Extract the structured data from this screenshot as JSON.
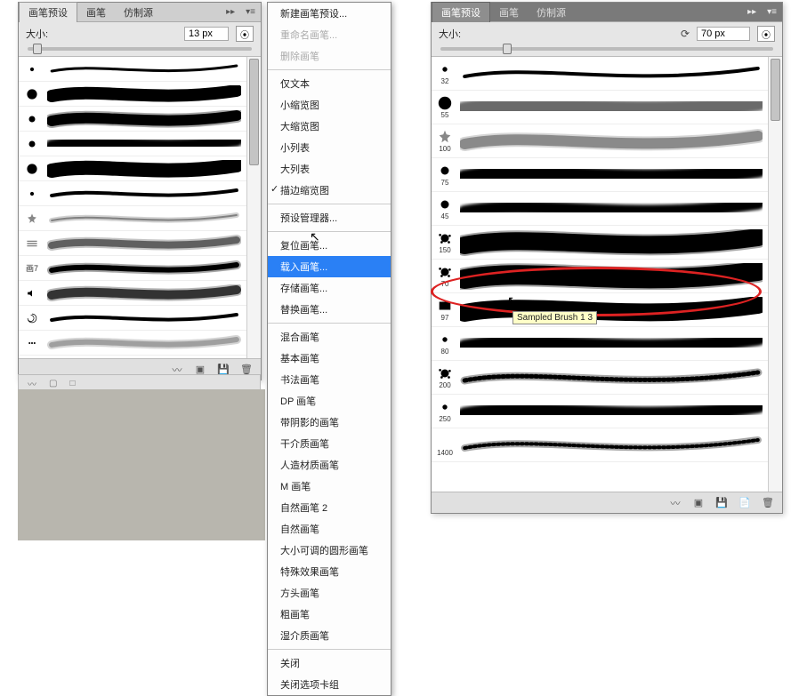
{
  "panel1": {
    "tabs": [
      "画笔预设",
      "画笔",
      "仿制源"
    ],
    "size_label": "大小:",
    "size_value": "13 px",
    "brushes": [
      {
        "num": "",
        "tip": "dot-sm"
      },
      {
        "num": "",
        "tip": "dot-lg"
      },
      {
        "num": "",
        "tip": "dot-md"
      },
      {
        "num": "",
        "tip": "dot-md"
      },
      {
        "num": "",
        "tip": "dot-lg"
      },
      {
        "num": "",
        "tip": "dot-sm"
      },
      {
        "num": "",
        "tip": "star"
      },
      {
        "num": "",
        "tip": "lines"
      },
      {
        "num": "画7",
        "tip": "label"
      },
      {
        "num": "",
        "tip": "sound"
      },
      {
        "num": "",
        "tip": "swirl"
      },
      {
        "num": "",
        "tip": "dots"
      }
    ]
  },
  "menu": {
    "items": [
      {
        "label": "新建画笔预设...",
        "type": "item"
      },
      {
        "label": "重命名画笔...",
        "type": "disabled"
      },
      {
        "label": "删除画笔",
        "type": "disabled"
      },
      {
        "type": "sep"
      },
      {
        "label": "仅文本",
        "type": "item"
      },
      {
        "label": "小缩览图",
        "type": "item"
      },
      {
        "label": "大缩览图",
        "type": "item"
      },
      {
        "label": "小列表",
        "type": "item"
      },
      {
        "label": "大列表",
        "type": "item"
      },
      {
        "label": "描边缩览图",
        "type": "checked"
      },
      {
        "type": "sep"
      },
      {
        "label": "预设管理器...",
        "type": "item"
      },
      {
        "type": "sep"
      },
      {
        "label": "复位画笔...",
        "type": "item"
      },
      {
        "label": "载入画笔...",
        "type": "highlight"
      },
      {
        "label": "存储画笔...",
        "type": "item"
      },
      {
        "label": "替换画笔...",
        "type": "item"
      },
      {
        "type": "sep"
      },
      {
        "label": "混合画笔",
        "type": "item"
      },
      {
        "label": "基本画笔",
        "type": "item"
      },
      {
        "label": "书法画笔",
        "type": "item"
      },
      {
        "label": "DP 画笔",
        "type": "item"
      },
      {
        "label": "带阴影的画笔",
        "type": "item"
      },
      {
        "label": "干介质画笔",
        "type": "item"
      },
      {
        "label": "人造材质画笔",
        "type": "item"
      },
      {
        "label": "M 画笔",
        "type": "item"
      },
      {
        "label": "自然画笔 2",
        "type": "item"
      },
      {
        "label": "自然画笔",
        "type": "item"
      },
      {
        "label": "大小可调的圆形画笔",
        "type": "item"
      },
      {
        "label": "特殊效果画笔",
        "type": "item"
      },
      {
        "label": "方头画笔",
        "type": "item"
      },
      {
        "label": "粗画笔",
        "type": "item"
      },
      {
        "label": "湿介质画笔",
        "type": "item"
      },
      {
        "type": "sep"
      },
      {
        "label": "关闭",
        "type": "item"
      },
      {
        "label": "关闭选项卡组",
        "type": "item"
      }
    ]
  },
  "panel2": {
    "tabs": [
      "画笔预设",
      "画笔",
      "仿制源"
    ],
    "size_label": "大小:",
    "size_value": "70 px",
    "tooltip": "Sampled Brush 1 3",
    "brushes": [
      {
        "num": "32",
        "tip": "dot-sm"
      },
      {
        "num": "55",
        "tip": "dot-lg"
      },
      {
        "num": "100",
        "tip": "star"
      },
      {
        "num": "75",
        "tip": "dot-md"
      },
      {
        "num": "45",
        "tip": "dot-md"
      },
      {
        "num": "150",
        "tip": "splat"
      },
      {
        "num": "70",
        "tip": "splat"
      },
      {
        "num": "97",
        "tip": "square"
      },
      {
        "num": "80",
        "tip": "dot-sm"
      },
      {
        "num": "200",
        "tip": "splat"
      },
      {
        "num": "250",
        "tip": "dot-sm"
      },
      {
        "num": "1400",
        "tip": "blank"
      }
    ]
  }
}
